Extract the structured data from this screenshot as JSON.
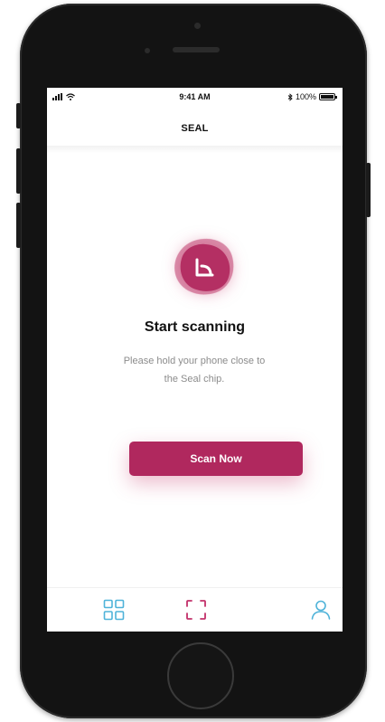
{
  "status_bar": {
    "time": "9:41 AM",
    "battery": "100%"
  },
  "header": {
    "title": "SEAL"
  },
  "main": {
    "icon": "scan-badge-icon",
    "headline": "Start scanning",
    "subtext_line1": "Please hold your phone close to",
    "subtext_line2": "the Seal chip.",
    "button_label": "Scan Now"
  },
  "tab_bar": {
    "items": [
      {
        "icon": "grid-icon"
      },
      {
        "icon": "scan-frame-icon"
      },
      {
        "icon": "user-icon"
      }
    ]
  },
  "colors": {
    "accent": "#b0285e",
    "tab_blue": "#4fb3d9",
    "tab_pink": "#c2306a"
  }
}
